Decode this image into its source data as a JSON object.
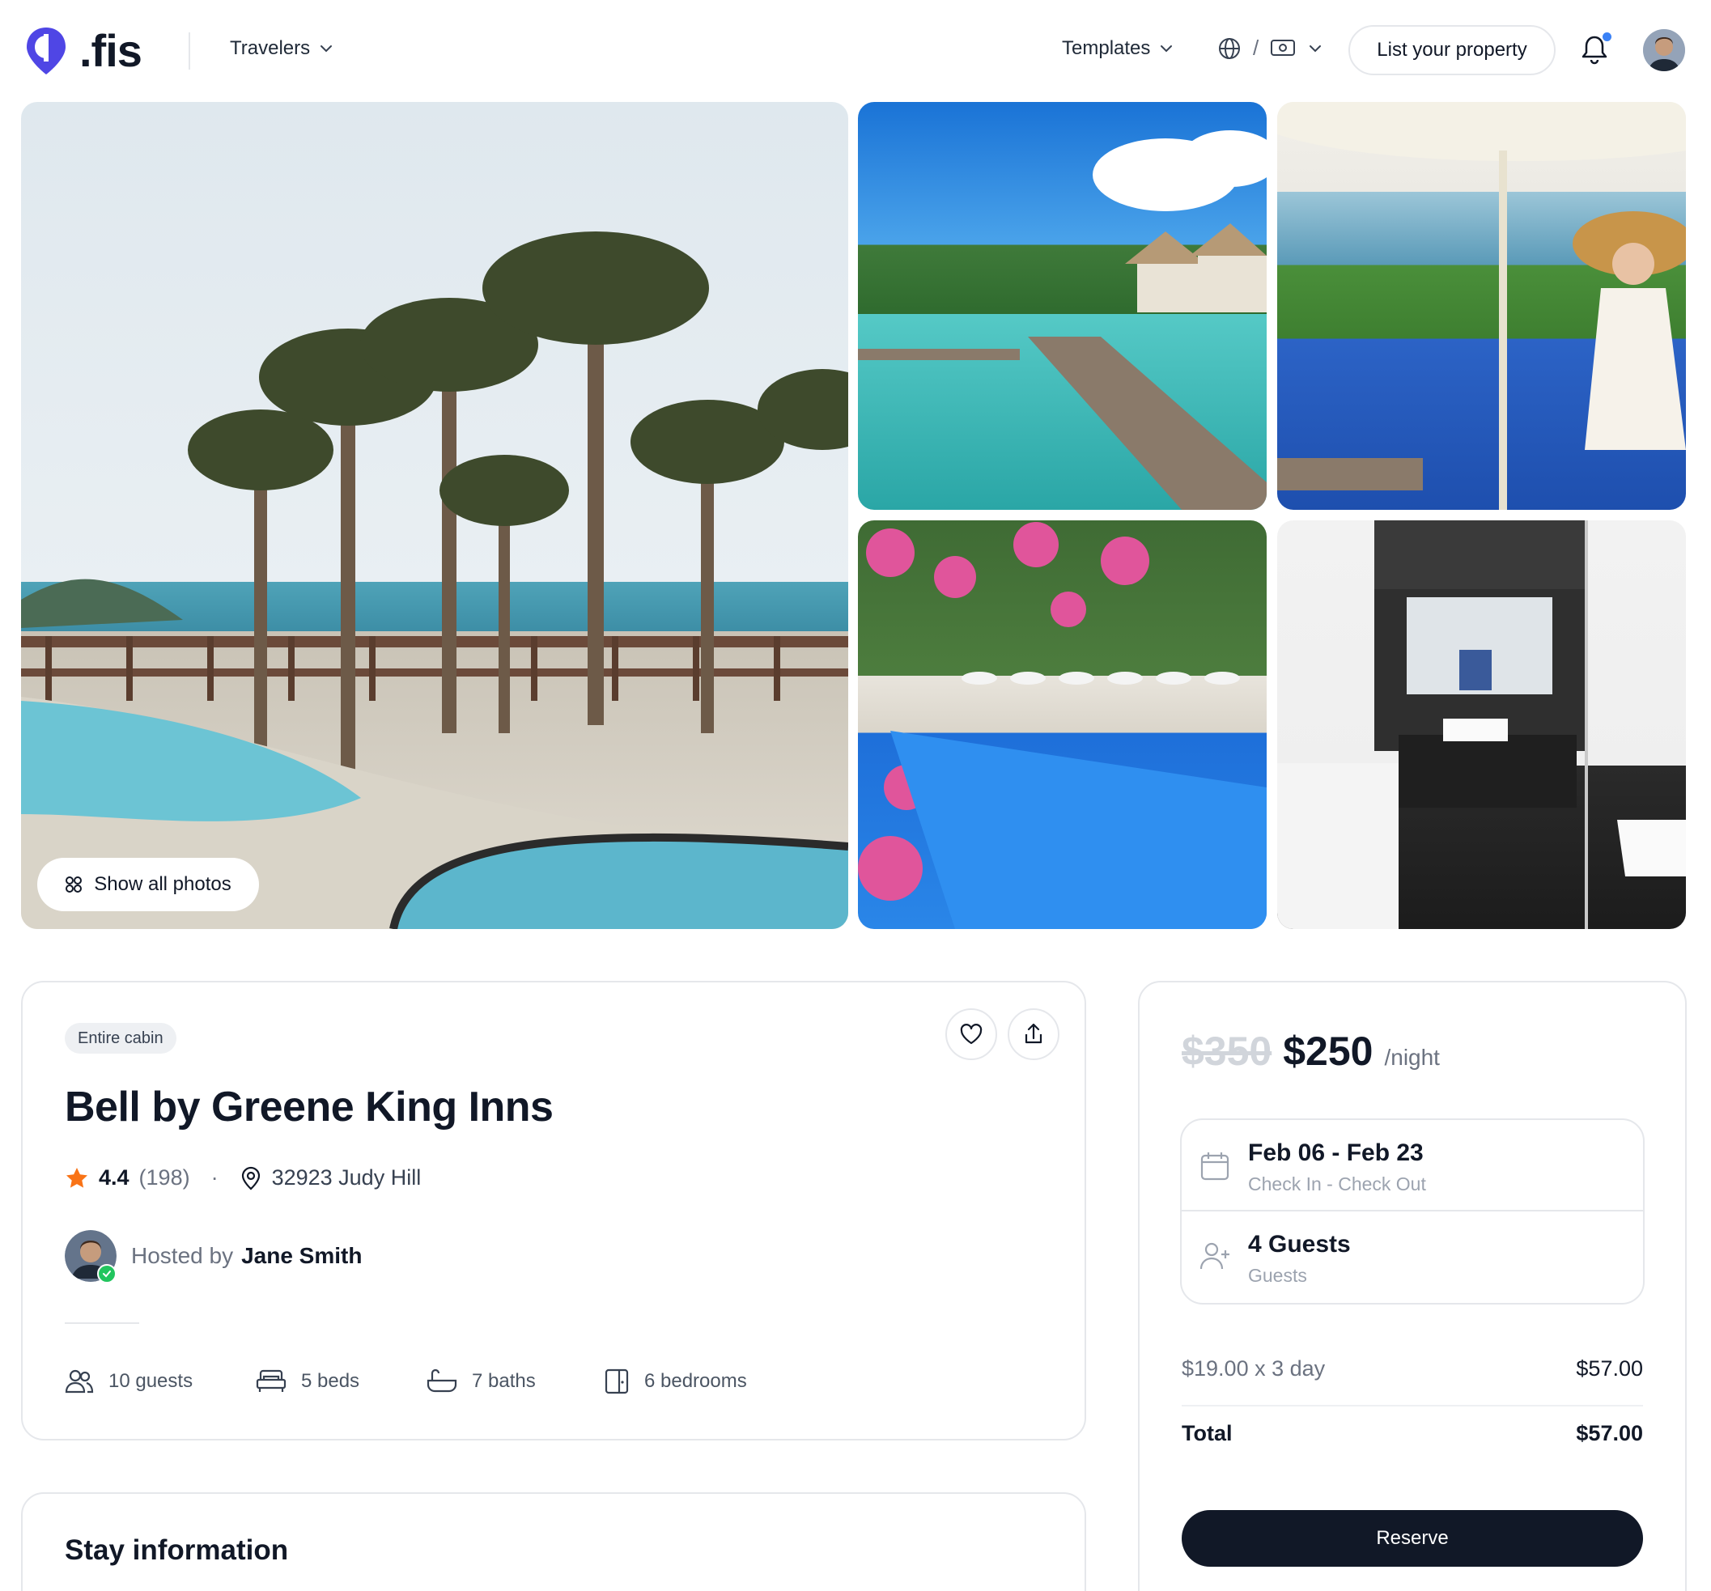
{
  "brand": {
    "name": ".fis",
    "accent": "#4f46e5"
  },
  "header": {
    "travelers_label": "Travelers",
    "templates_label": "Templates",
    "separator": "/",
    "list_property_label": "List your property"
  },
  "gallery": {
    "show_all_label": "Show all photos"
  },
  "listing": {
    "type_badge": "Entire cabin",
    "title": "Bell by Greene King Inns",
    "rating": "4.4",
    "reviews": "(198)",
    "dot": "·",
    "address": "32923 Judy Hill",
    "hosted_prefix": "Hosted by",
    "host_name": "Jane Smith",
    "amenities": [
      {
        "icon": "guests-icon",
        "label": "10 guests"
      },
      {
        "icon": "bed-icon",
        "label": "5 beds"
      },
      {
        "icon": "bath-icon",
        "label": "7 baths"
      },
      {
        "icon": "door-icon",
        "label": "6 bedrooms"
      }
    ]
  },
  "stay": {
    "heading": "Stay information"
  },
  "booking": {
    "old_price": "$350",
    "price": "$250",
    "per": "/night",
    "dates": "Feb 06 - Feb 23",
    "dates_sub": "Check In - Check Out",
    "guests": "4 Guests",
    "guests_sub": "Guests",
    "line_label": "$19.00 x 3 day",
    "line_value": "$57.00",
    "total_label": "Total",
    "total_value": "$57.00",
    "reserve_label": "Reserve"
  },
  "colors": {
    "star": "#f97316",
    "notification_dot": "#3b82f6",
    "verified": "#22c55e",
    "reserve_bg": "#111827"
  }
}
